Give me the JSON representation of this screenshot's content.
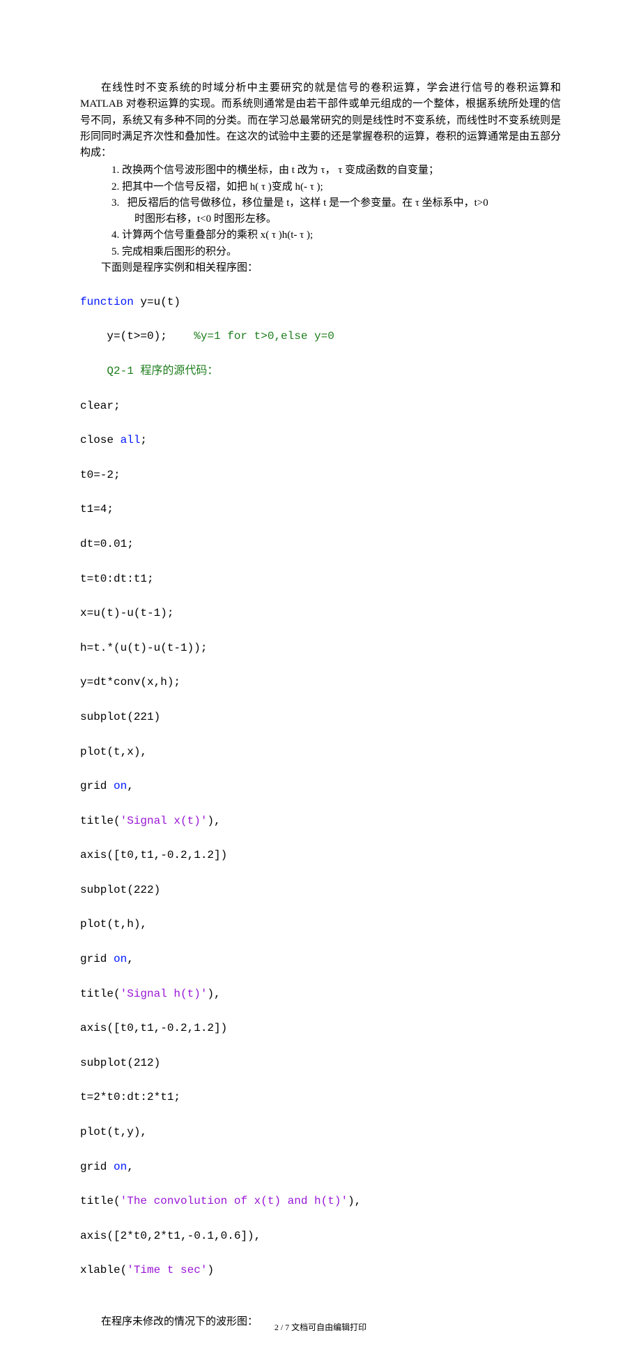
{
  "intro": "在线性时不变系统的时域分析中主要研究的就是信号的卷积运算，学会进行信号的卷积运算和 MATLAB 对卷积运算的实现。而系统则通常是由若干部件或单元组成的一个整体，根据系统所处理的信号不同，系统又有多种不同的分类。而在学习总最常研究的则是线性时不变系统，而线性时不变系统则是形同同时满足齐次性和叠加性。在这次的试验中主要的还是掌握卷积的运算，卷积的运算通常是由五部分构成：",
  "steps": [
    "1.   改换两个信号波形图中的横坐标，由 t 改为 τ， τ 变成函数的自变量；",
    "2.   把其中一个信号反褶，如把 h( τ )变成 h(- τ );",
    "3.   把反褶后的信号做移位，移位量是 t，这样 t 是一个参变量。在 τ 坐标系中，t>0\n时图形右移，t<0 时图形左移。",
    "4.   计算两个信号重叠部分的乘积 x( τ )h(t- τ );",
    "5.   完成相乘后图形的积分。"
  ],
  "steps_followup": "下面则是程序实例和相关程序图：",
  "code": {
    "l1": {
      "kw": "function",
      "rest": " y=u(t)"
    },
    "l2": {
      "body": "y=(t>=0);    ",
      "cm": "%y=1 for t>0,else y=0"
    },
    "l3_cm": "Q2-1 程序的源代码：",
    "l4": "clear;",
    "l5": {
      "pre": "close ",
      "kw": "all",
      "post": ";"
    },
    "l6": "t0=-2;",
    "l7": "t1=4;",
    "l8": "dt=0.01;",
    "l9": "t=t0:dt:t1;",
    "l10": "x=u(t)-u(t-1);",
    "l11": "h=t.*(u(t)-u(t-1));",
    "l12": "y=dt*conv(x,h);",
    "l13": "subplot(221)",
    "l14": "plot(t,x),",
    "l15": {
      "pre": "grid ",
      "kw": "on",
      "post": ","
    },
    "l16": {
      "pre": "title(",
      "str": "'Signal x(t)'",
      "post": "),"
    },
    "l17": "axis([t0,t1,-0.2,1.2])",
    "l18": "subplot(222)",
    "l19": "plot(t,h),",
    "l20": {
      "pre": "grid ",
      "kw": "on",
      "post": ","
    },
    "l21": {
      "pre": "title(",
      "str": "'Signal h(t)'",
      "post": "),"
    },
    "l22": "axis([t0,t1,-0.2,1.2])",
    "l23": "subplot(212)",
    "l24": "t=2*t0:dt:2*t1;",
    "l25": "plot(t,y),",
    "l26": {
      "pre": "grid ",
      "kw": "on",
      "post": ","
    },
    "l27": {
      "pre": "title(",
      "str": "'The convolution of x(t) and h(t)'",
      "post": "),"
    },
    "l28": "axis([2*t0,2*t1,-0.1,0.6]),",
    "l29": {
      "pre": "xlable(",
      "str": "'Time t sec'",
      "post": ")"
    }
  },
  "closing": "在程序未修改的情况下的波形图：",
  "footer": "2 / 7 文档可自由编辑打印"
}
